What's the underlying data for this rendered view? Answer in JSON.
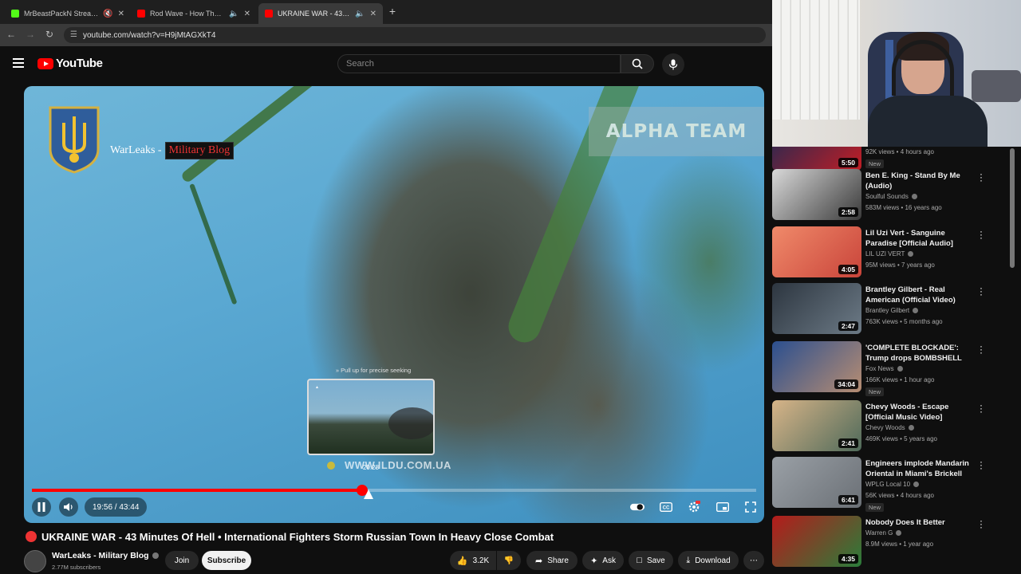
{
  "browser": {
    "tabs": [
      {
        "title": "MrBeastPackN Stream - Wa",
        "fav_color": "#53fc18"
      },
      {
        "title": "Rod Wave - How The Game",
        "fav_color": "#ff0000"
      },
      {
        "title": "UKRAINE WAR - 43 Min",
        "fav_color": "#ff0000"
      }
    ],
    "url": "youtube.com/watch?v=H9jMtAGXkT4"
  },
  "youtube": {
    "logo_text": "YouTube",
    "search_placeholder": "Search"
  },
  "player": {
    "overlay": {
      "channel_text": "WarLeaks -",
      "channel_badge": "Military Blog",
      "team_banner": "ALPHA TEAM",
      "seek_hint": "» Pull up for precise seeking",
      "preview_time": "20:28",
      "watermark": "WWW.ILDU.COM.UA"
    },
    "time_display": "19:56 / 43:44",
    "progress_fraction": 0.456
  },
  "video": {
    "title": "UKRAINE WAR - 43 Minutes Of Hell • International Fighters Storm Russian Town In Heavy Close Combat",
    "channel": "WarLeaks - Military Blog",
    "subscribers": "2.77M subscribers",
    "join_label": "Join",
    "subscribe_label": "Subscribe",
    "likes": "3.2K",
    "share_label": "Share",
    "ask_label": "Ask",
    "save_label": "Save",
    "download_label": "Download"
  },
  "recommendations": [
    {
      "title": "",
      "channel": "",
      "meta": "92K views • 4 hours ago",
      "duration": "5:50",
      "badge": "New",
      "thumb_colors": [
        "#1a2a55",
        "#c21d24"
      ]
    },
    {
      "title": "Ben E. King - Stand By Me (Audio)",
      "channel": "Soulful Sounds",
      "meta": "583M views • 16 years ago",
      "duration": "2:58",
      "badge": "",
      "thumb_colors": [
        "#d9d9d9",
        "#3a3a3a"
      ]
    },
    {
      "title": "Lil Uzi Vert - Sanguine Paradise [Official Audio]",
      "channel": "LIL UZI VERT",
      "meta": "95M views • 7 years ago",
      "duration": "4:05",
      "badge": "",
      "thumb_colors": [
        "#f08a6a",
        "#c9443a"
      ]
    },
    {
      "title": "Brantley Gilbert - Real American (Official Video)",
      "channel": "Brantley Gilbert",
      "meta": "763K views • 5 months ago",
      "duration": "2:47",
      "badge": "",
      "thumb_colors": [
        "#2d3640",
        "#6c7a86"
      ]
    },
    {
      "title": "'COMPLETE BLOCKADE': Trump drops BOMBSHELL move in ...",
      "channel": "Fox News",
      "meta": "166K views • 1 hour ago",
      "duration": "34:04",
      "badge": "New",
      "thumb_colors": [
        "#2b4f8f",
        "#b78d72"
      ]
    },
    {
      "title": "Chevy Woods - Escape [Official Music Video]",
      "channel": "Chevy Woods",
      "meta": "469K views • 5 years ago",
      "duration": "2:41",
      "badge": "",
      "thumb_colors": [
        "#d7b488",
        "#4f6a5a"
      ]
    },
    {
      "title": "Engineers implode Mandarin Oriental in Miami's Brickell Key",
      "channel": "WPLG Local 10",
      "meta": "56K views • 4 hours ago",
      "duration": "6:41",
      "badge": "New",
      "thumb_colors": [
        "#9aa0a6",
        "#6b7076"
      ]
    },
    {
      "title": "Nobody Does It Better",
      "channel": "Warren G",
      "meta": "8.9M views • 1 year ago",
      "duration": "4:35",
      "badge": "",
      "thumb_colors": [
        "#b51b1b",
        "#2a7d3a"
      ]
    }
  ]
}
